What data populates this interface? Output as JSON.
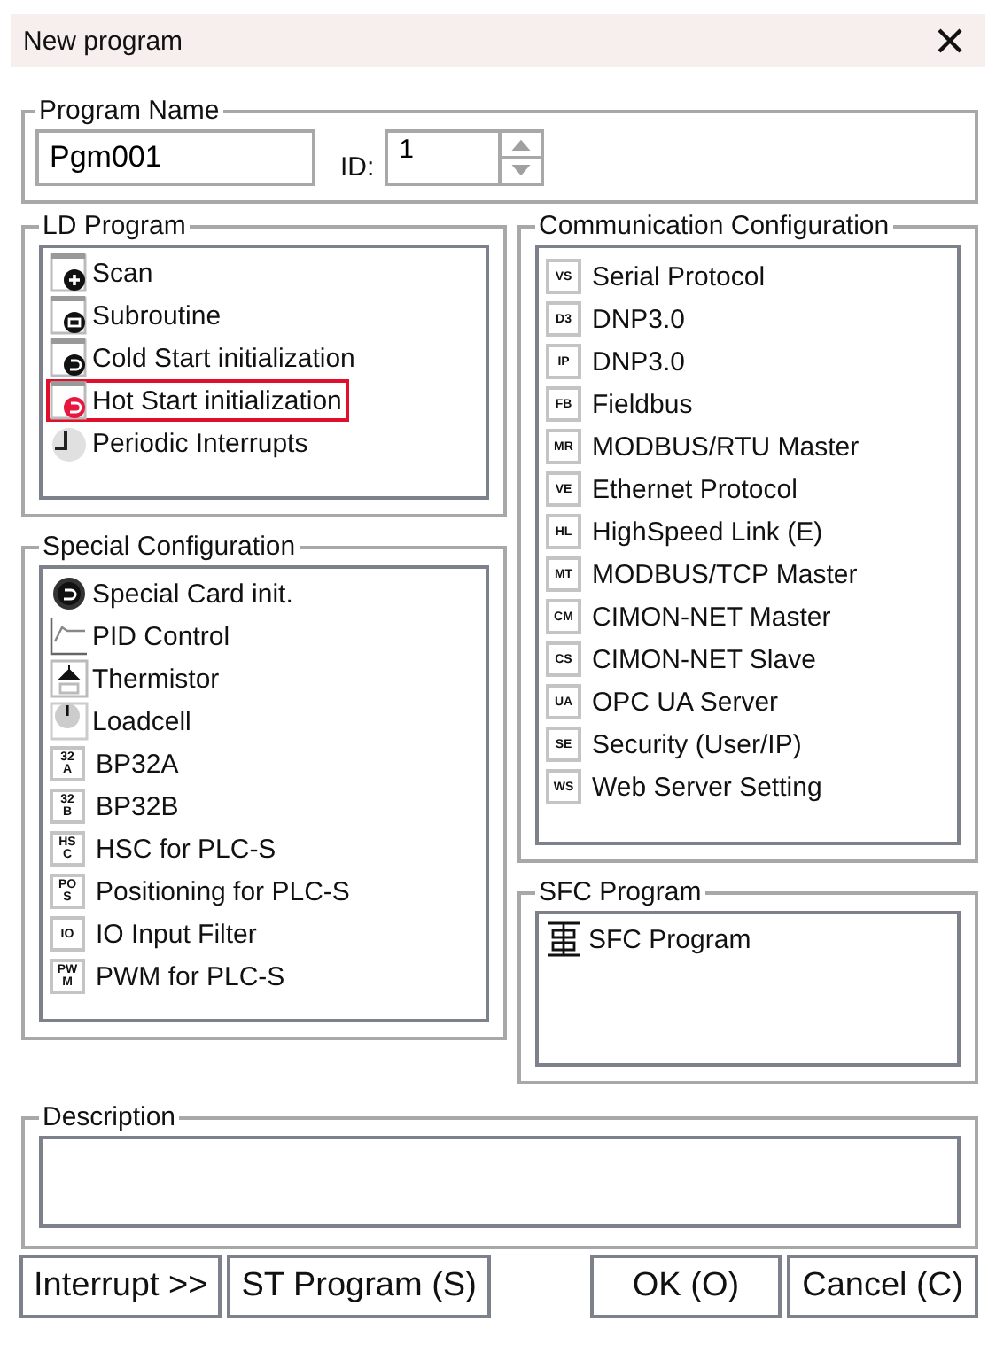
{
  "window": {
    "title": "New program"
  },
  "program_name": {
    "label": "Program Name",
    "value": "Pgm001",
    "id_label": "ID:",
    "id_value": "1"
  },
  "ld_program": {
    "label": "LD Program",
    "items": [
      {
        "label": "Scan",
        "kind": "scan",
        "selected": false
      },
      {
        "label": "Subroutine",
        "kind": "subroutine",
        "selected": false
      },
      {
        "label": "Cold Start initialization",
        "kind": "cold",
        "selected": false
      },
      {
        "label": "Hot Start initialization",
        "kind": "hot",
        "selected": true
      },
      {
        "label": "Periodic Interrupts",
        "kind": "periodic",
        "selected": false
      }
    ]
  },
  "special_configuration": {
    "label": "Special Configuration",
    "items": [
      {
        "label": "Special Card init.",
        "kind": "card"
      },
      {
        "label": "PID Control",
        "kind": "pid"
      },
      {
        "label": "Thermistor",
        "kind": "thermistor"
      },
      {
        "label": "Loadcell",
        "kind": "loadcell"
      },
      {
        "label": "BP32A",
        "kind": "badge",
        "badge": [
          "32",
          "A"
        ]
      },
      {
        "label": "BP32B",
        "kind": "badge",
        "badge": [
          "32",
          "B"
        ]
      },
      {
        "label": "HSC for PLC-S",
        "kind": "badge",
        "badge": [
          "HS",
          "C"
        ]
      },
      {
        "label": "Positioning for PLC-S",
        "kind": "badge",
        "badge": [
          "PO",
          "S"
        ]
      },
      {
        "label": "IO Input Filter",
        "kind": "badge",
        "badge": [
          "IO"
        ]
      },
      {
        "label": "PWM for PLC-S",
        "kind": "badge",
        "badge": [
          "PW",
          "M"
        ]
      }
    ]
  },
  "communication_configuration": {
    "label": "Communication Configuration",
    "items": [
      {
        "label": "Serial Protocol",
        "badge": "VS"
      },
      {
        "label": "DNP3.0",
        "badge": "D3"
      },
      {
        "label": "DNP3.0",
        "badge": "IP"
      },
      {
        "label": "Fieldbus",
        "badge": "FB"
      },
      {
        "label": "MODBUS/RTU Master",
        "badge": "MR"
      },
      {
        "label": "Ethernet Protocol",
        "badge": "VE"
      },
      {
        "label": "HighSpeed Link (E)",
        "badge": "HL"
      },
      {
        "label": "MODBUS/TCP Master",
        "badge": "MT"
      },
      {
        "label": "CIMON-NET Master",
        "badge": "CM"
      },
      {
        "label": "CIMON-NET Slave",
        "badge": "CS"
      },
      {
        "label": "OPC UA Server",
        "badge": "UA"
      },
      {
        "label": "Security (User/IP)",
        "badge": "SE"
      },
      {
        "label": "Web Server Setting",
        "badge": "WS"
      }
    ]
  },
  "sfc_program": {
    "label": "SFC Program",
    "items": [
      {
        "label": "SFC Program"
      }
    ]
  },
  "description": {
    "label": "Description"
  },
  "buttons_left": [
    "Interrupt >>",
    "ST Program (S)"
  ],
  "buttons_right": [
    "OK (O)",
    "Cancel (C)"
  ]
}
